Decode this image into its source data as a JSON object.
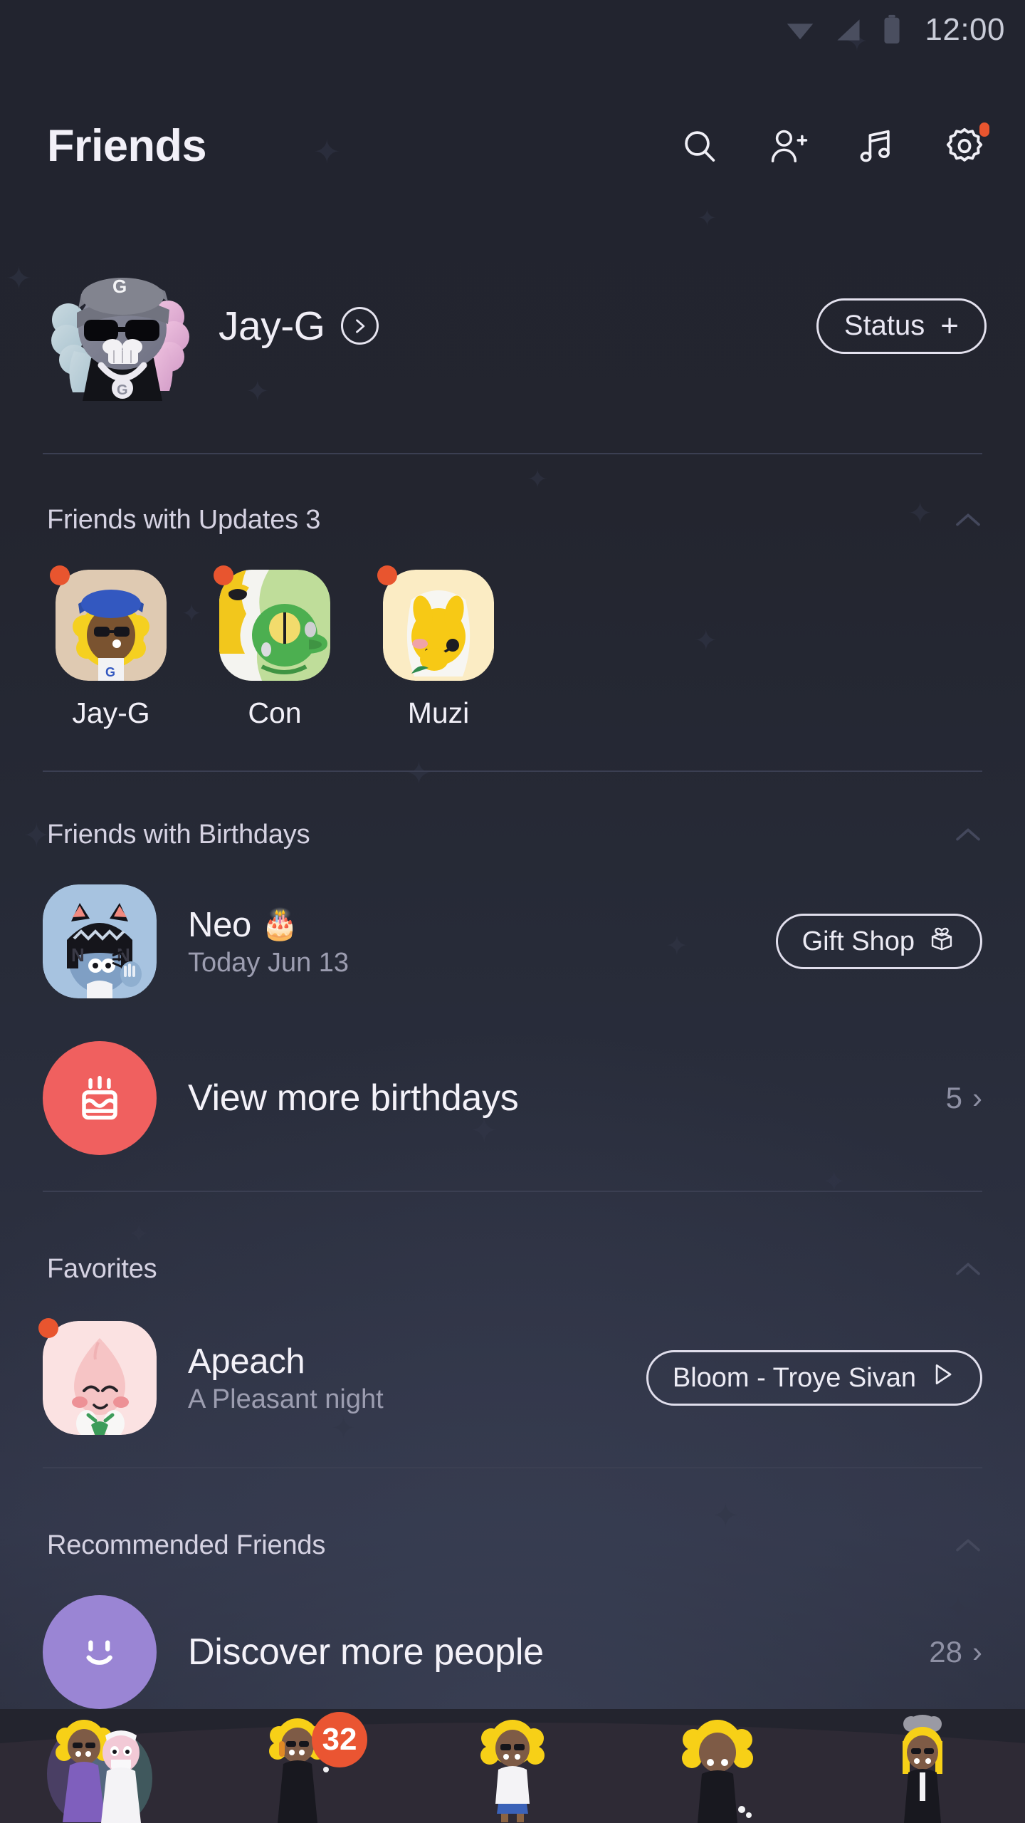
{
  "status_bar": {
    "time": "12:00",
    "icons": [
      "wifi-icon",
      "cellular-signal-icon",
      "battery-icon"
    ]
  },
  "header": {
    "title": "Friends",
    "actions": [
      {
        "name": "search-icon",
        "label": "Search",
        "badge": false
      },
      {
        "name": "add-friend-icon",
        "label": "Add friend",
        "badge": false
      },
      {
        "name": "music-note-icon",
        "label": "Music",
        "badge": false
      },
      {
        "name": "gear-icon",
        "label": "Settings",
        "badge": true
      }
    ]
  },
  "profile": {
    "name": "Jay-G",
    "chevron_icon": "chevron-right-circle-icon",
    "status_button": {
      "label": "Status",
      "plus": "+"
    }
  },
  "sections": {
    "updates": {
      "title": "Friends with Updates 3",
      "collapse_icon": "chevron-up-icon",
      "friends": [
        {
          "name": "Jay-G",
          "has_update": true
        },
        {
          "name": "Con",
          "has_update": true
        },
        {
          "name": "Muzi",
          "has_update": true
        }
      ]
    },
    "birthdays": {
      "title": "Friends with Birthdays",
      "collapse_icon": "chevron-up-icon",
      "entry": {
        "name": "Neo",
        "cake_emoji": "🎂",
        "date": "Today Jun 13",
        "button": {
          "label": "Gift Shop",
          "icon": "gift-box-heart-icon"
        }
      },
      "view_more": {
        "label": "View more birthdays",
        "count": "5",
        "chevron": "›",
        "icon": "birthday-cake-icon",
        "icon_color": "#f0605f"
      }
    },
    "favorites": {
      "title": "Favorites",
      "collapse_icon": "chevron-up-icon",
      "entry": {
        "name": "Apeach",
        "status_message": "A Pleasant night",
        "has_update": true,
        "music_button": {
          "label": "Bloom - Troye Sivan",
          "icon": "play-icon"
        }
      }
    },
    "recommended": {
      "title": "Recommended Friends",
      "collapse_icon": "chevron-up-icon",
      "discover": {
        "label": "Discover more people",
        "count": "28",
        "chevron": "›",
        "icon": "smiley-face-icon",
        "icon_color": "#9a85d4"
      }
    }
  },
  "bottom_nav": {
    "items": [
      {
        "name": "tab-friends",
        "active": true,
        "badge": null
      },
      {
        "name": "tab-chats",
        "active": false,
        "badge": "32"
      },
      {
        "name": "tab-view",
        "active": false,
        "badge": null
      },
      {
        "name": "tab-shopping",
        "active": false,
        "badge": null
      },
      {
        "name": "tab-more",
        "active": false,
        "badge": null
      }
    ]
  },
  "colors": {
    "background_top": "#22242f",
    "background_mid": "#2c3040",
    "accent_orange": "#e8552f",
    "accent_red": "#f0605f",
    "accent_purple": "#9a85d4",
    "text_primary": "#f3f1f8",
    "text_secondary": "#9c9db0",
    "divider": "#3b3f52"
  }
}
